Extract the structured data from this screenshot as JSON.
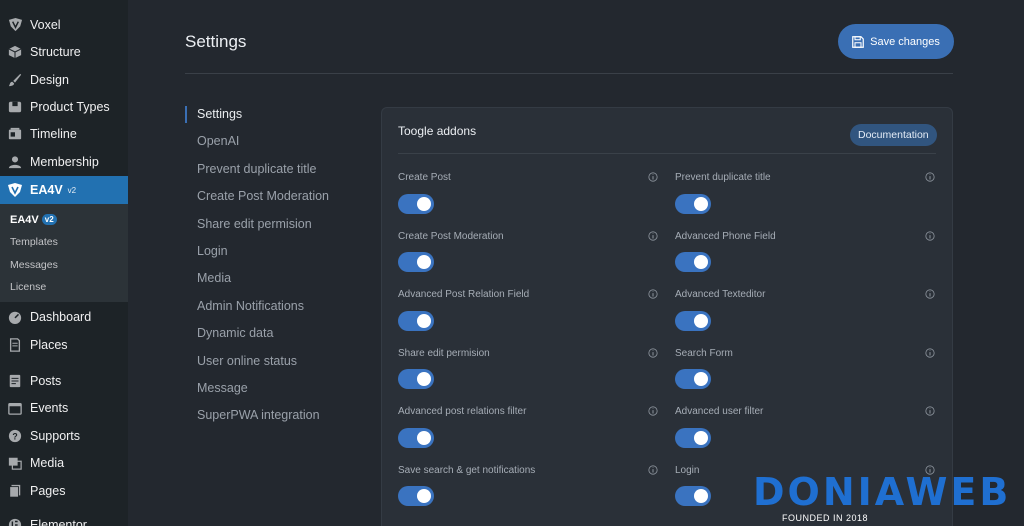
{
  "colors": {
    "accent": "#3a6fb4",
    "sidebar_bg": "#1d2327",
    "wp_active": "#2271b1",
    "main_bg": "#23282f",
    "card_bg": "#2a3038",
    "toggle_on": "#3a73c0"
  },
  "wp_menu": [
    {
      "label": "Voxel",
      "icon": "voxel-icon"
    },
    {
      "label": "Structure",
      "icon": "cube-icon"
    },
    {
      "label": "Design",
      "icon": "brush-icon"
    },
    {
      "label": "Product Types",
      "icon": "box-icon"
    },
    {
      "label": "Timeline",
      "icon": "timeline-icon"
    },
    {
      "label": "Membership",
      "icon": "user-icon"
    },
    {
      "label": "EA4V",
      "icon": "ea4v-icon",
      "version": "v2"
    },
    {
      "label": "Dashboard",
      "icon": "dashboard-icon"
    },
    {
      "label": "Places",
      "icon": "places-icon"
    },
    {
      "label": "Posts",
      "icon": "posts-icon"
    },
    {
      "label": "Events",
      "icon": "events-icon"
    },
    {
      "label": "Supports",
      "icon": "supports-icon"
    },
    {
      "label": "Media",
      "icon": "media-icon"
    },
    {
      "label": "Pages",
      "icon": "pages-icon"
    },
    {
      "label": "Elementor",
      "icon": "elementor-icon"
    }
  ],
  "wp_submenu": {
    "current": "EA4V",
    "badge": "v2",
    "items": [
      "Templates",
      "Messages",
      "License"
    ]
  },
  "page_title": "Settings",
  "save_label": "Save changes",
  "settings_nav": [
    "Settings",
    "OpenAI",
    "Prevent duplicate title",
    "Create Post Moderation",
    "Share edit permision",
    "Login",
    "Media",
    "Admin Notifications",
    "Dynamic data",
    "User online status",
    "Message",
    "SuperPWA integration"
  ],
  "card": {
    "title": "Toogle addons",
    "doc_label": "Documentation",
    "addons": [
      {
        "label": "Create Post",
        "enabled": true
      },
      {
        "label": "Prevent duplicate title",
        "enabled": true
      },
      {
        "label": "Create Post Moderation",
        "enabled": true
      },
      {
        "label": "Advanced Phone Field",
        "enabled": true
      },
      {
        "label": "Advanced Post Relation Field",
        "enabled": true
      },
      {
        "label": "Advanced Texteditor",
        "enabled": true
      },
      {
        "label": "Share edit permision",
        "enabled": true
      },
      {
        "label": "Search Form",
        "enabled": true
      },
      {
        "label": "Advanced post relations filter",
        "enabled": true
      },
      {
        "label": "Advanced user filter",
        "enabled": true
      },
      {
        "label": "Save search & get notifications",
        "enabled": true
      },
      {
        "label": "Login",
        "enabled": true
      }
    ]
  },
  "watermark": {
    "brand": "DONIAWEB",
    "tagline": "FOUNDED IN 2018"
  }
}
